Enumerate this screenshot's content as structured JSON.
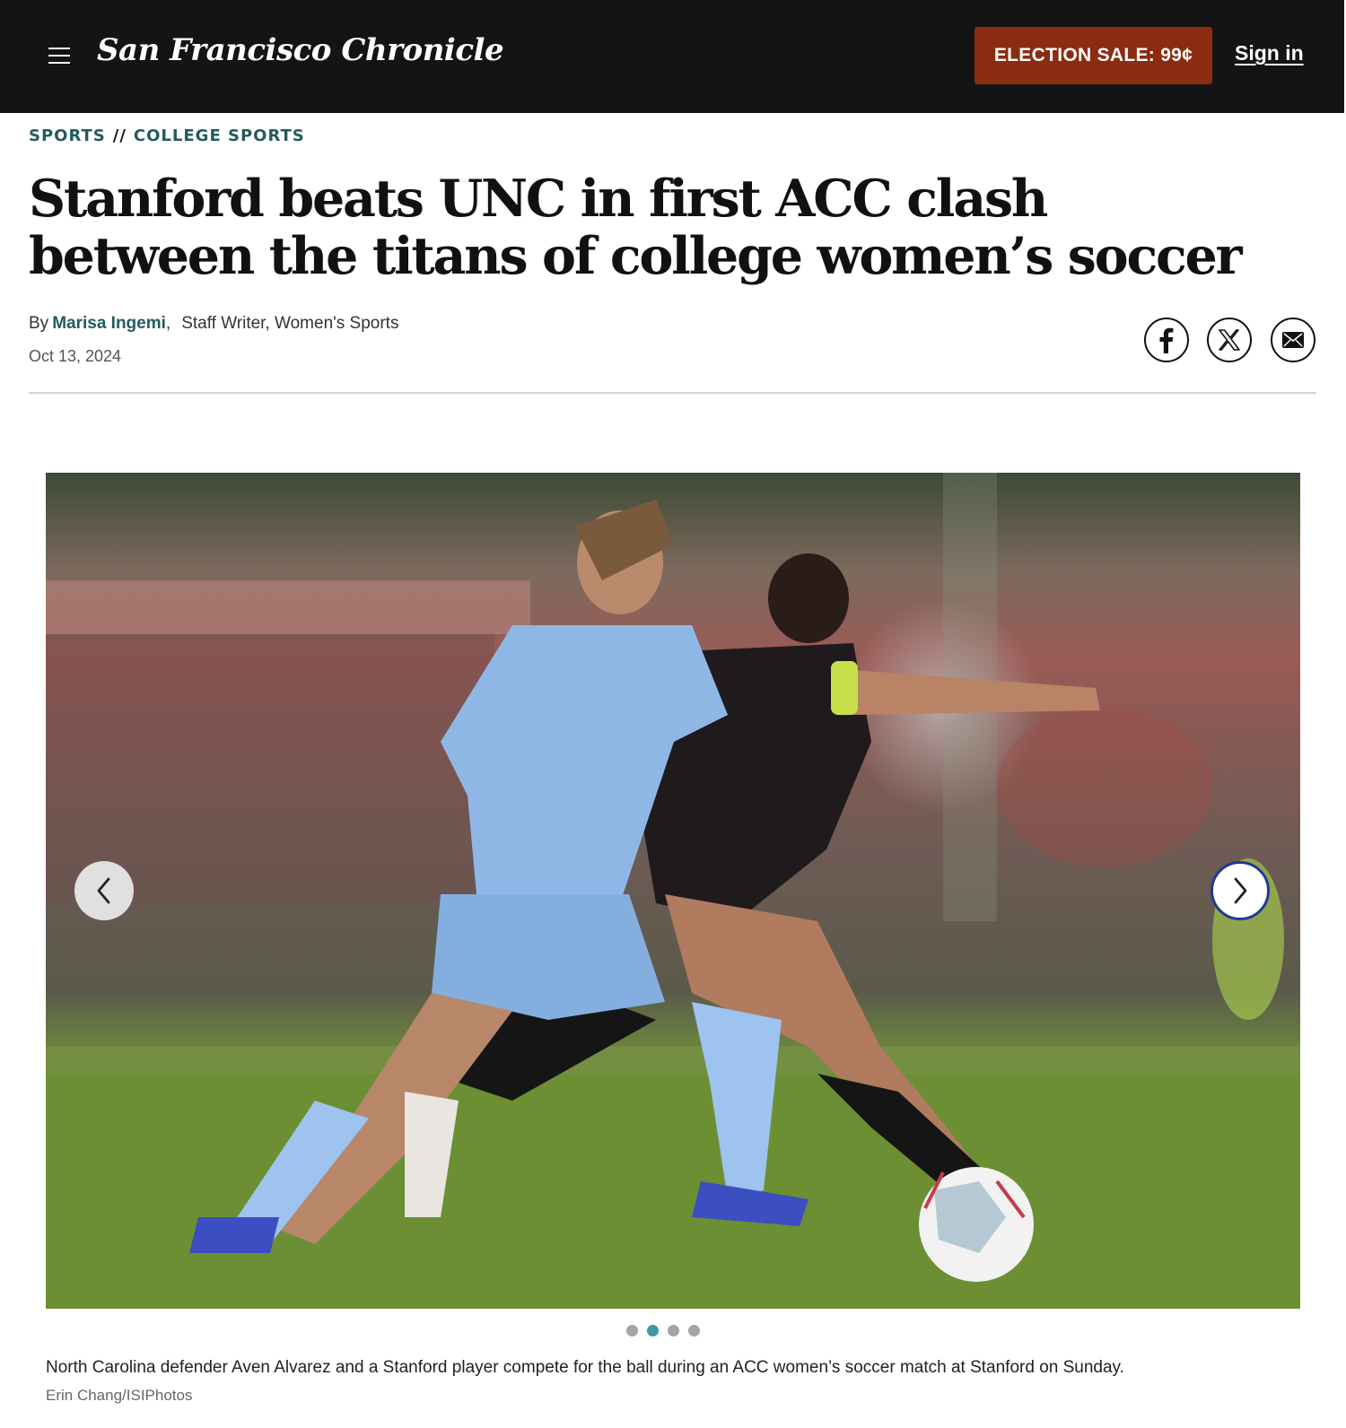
{
  "header": {
    "logo_text": "San Francisco Chronicle",
    "sale_button": "ELECTION SALE: 99¢",
    "signin": "Sign in",
    "background": "#141414",
    "sale_color": "#8a2c12"
  },
  "breadcrumb": {
    "section": "SPORTS",
    "separator": "//",
    "subsection": "COLLEGE SPORTS"
  },
  "article": {
    "headline": "Stanford beats UNC in first ACC clash between the titans of college women’s soccer",
    "by": "By",
    "author": "Marisa Ingemi",
    "author_role": "Staff Writer, Women's Sports",
    "date": "Oct 13, 2024"
  },
  "share": {
    "icons": [
      "facebook-icon",
      "x-twitter-icon",
      "email-icon"
    ]
  },
  "gallery": {
    "slide_count": 4,
    "active_slide": 2,
    "caption": "North Carolina defender Aven Alvarez and a Stanford player compete for the ball during an ACC women’s soccer match at Stanford on Sunday.",
    "credit": "Erin Chang/ISIPhotos",
    "prev_icon": "chevron-left-icon",
    "next_icon": "chevron-right-icon"
  },
  "colors": {
    "accent_teal": "#245a5f",
    "active_dot": "#3c9aa3",
    "next_border": "#1f3a93"
  }
}
